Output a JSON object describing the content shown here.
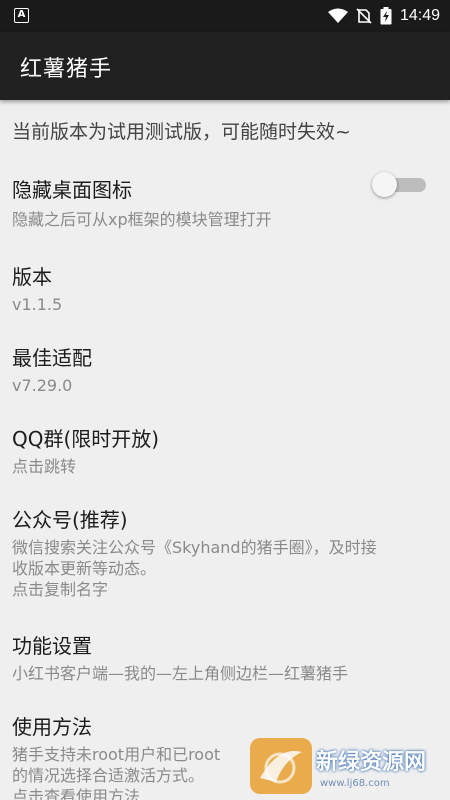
{
  "status_bar": {
    "left_icon_letter": "A",
    "time": "14:49",
    "icons": [
      "wifi-icon",
      "no-sim-icon",
      "battery-charging-icon"
    ]
  },
  "app_bar": {
    "title": "红薯猪手"
  },
  "notice": "当前版本为试用测试版，可能随时失效~",
  "items": [
    {
      "title": "隐藏桌面图标",
      "subtitle": "隐藏之后可从xp框架的模块管理打开",
      "toggle_on": false
    },
    {
      "title": "版本",
      "subtitle": "v1.1.5"
    },
    {
      "title": "最佳适配",
      "subtitle": "v7.29.0"
    },
    {
      "title": "QQ群(限时开放)",
      "subtitle": "点击跳转"
    },
    {
      "title": "公众号(推荐)",
      "subtitle_lines": [
        "微信搜索关注公众号《Skyhand的猪手圈》，及时接",
        "收版本更新等动态。",
        "点击复制名字"
      ]
    },
    {
      "title": "功能设置",
      "subtitle": "小红书客户端—我的—左上角侧边栏—红薯猪手"
    },
    {
      "title": "使用方法",
      "subtitle_lines": [
        "猪手支持未root用户和已root",
        "的情况选择合适激活方式。",
        "点击查看使用方法"
      ]
    }
  ],
  "watermark": {
    "text": "新绿资源网",
    "url": "www.lj68.com"
  },
  "colors": {
    "app_bar": "#212121",
    "status_bar": "#1a1a1a",
    "background": "#efefef",
    "toggle_off_track": "#bdbdbd"
  }
}
